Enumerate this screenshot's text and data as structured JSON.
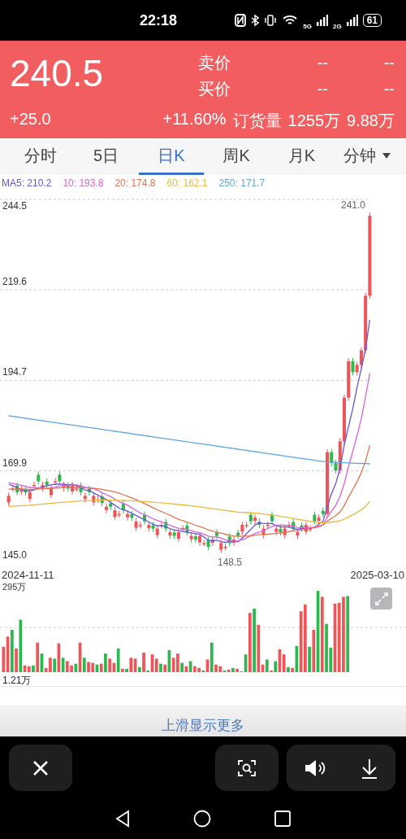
{
  "status_bar": {
    "time": "22:18",
    "network_labels": [
      "5G",
      "2G"
    ],
    "battery": "61"
  },
  "quote": {
    "price": "240.5",
    "change": "+25.0",
    "change_pct": "+11.60%",
    "ask_label": "卖价",
    "ask_values": [
      "--",
      "--"
    ],
    "bid_label": "买价",
    "bid_values": [
      "--",
      "--"
    ],
    "volume_label": "订货量",
    "volume": "1255万",
    "amount": "9.88万"
  },
  "tabs": [
    {
      "label": "分时",
      "selected": false,
      "has_menu": false
    },
    {
      "label": "5日",
      "selected": false,
      "has_menu": false
    },
    {
      "label": "日K",
      "selected": true,
      "has_menu": false
    },
    {
      "label": "周K",
      "selected": false,
      "has_menu": false
    },
    {
      "label": "月K",
      "selected": false,
      "has_menu": false
    },
    {
      "label": "分钟",
      "selected": false,
      "has_menu": true
    }
  ],
  "ma_legend": [
    {
      "label": "MA5: 210.2",
      "color": "#6656d8"
    },
    {
      "label": "10: 193.8",
      "color": "#d862d8"
    },
    {
      "label": "20: 174.8",
      "color": "#e2734f"
    },
    {
      "label": "60: 162.1",
      "color": "#eab93c"
    },
    {
      "label": "250: 171.7",
      "color": "#5ea6dc"
    }
  ],
  "price_chart": {
    "yticks": [
      "244.5",
      "219.6",
      "194.7",
      "169.9",
      "145.0"
    ],
    "high_label": "241.0",
    "low_label": "148.5",
    "start_date": "2024-11-11",
    "end_date": "2025-03-10"
  },
  "volume_chart": {
    "max_label": "295万",
    "min_label": "1.21万"
  },
  "swipe_hint": "上滑显示更多"
}
